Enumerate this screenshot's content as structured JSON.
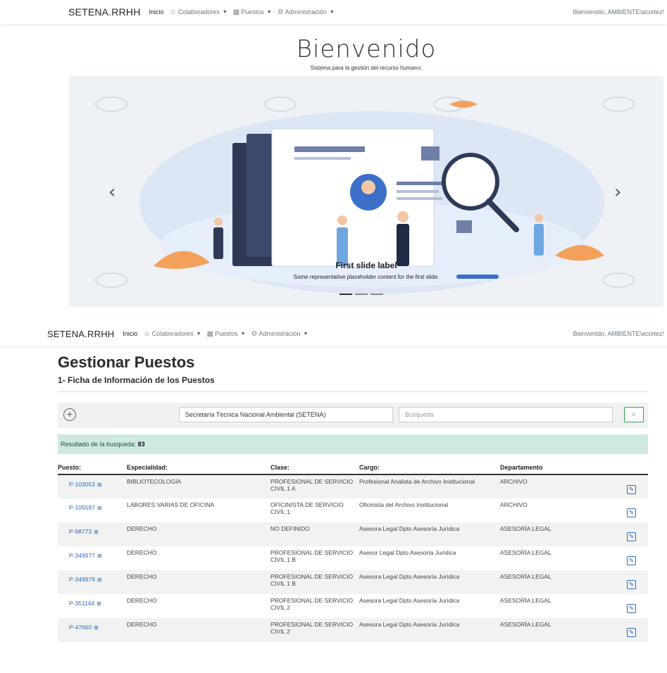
{
  "nav_top": {
    "brand": "SETENA.RRHH",
    "home": "Inicio",
    "colaboradores": "Colaboradores",
    "puestos": "Puestos",
    "administracion": "Administración",
    "welcome": "Bienvenido, AMBIENTE\\acortez!"
  },
  "nav_mid": {
    "brand": "SETENA.RRHH",
    "home": "Inicio",
    "colaboradores": "Colaboradores",
    "puestos": "Puestos",
    "administracion": "Administración",
    "welcome": "Bienvenido, AMBIENTE\\acortez!"
  },
  "hero": {
    "title": "Bienvenido",
    "subtitle": "Sistema para la gestión del recurso humano."
  },
  "carousel": {
    "prev_glyph": "‹",
    "next_glyph": "›",
    "caption_label": "First slide label",
    "caption_text": "Some representative placeholder content for the first slide."
  },
  "page": {
    "title": "Gestionar Puestos",
    "subtitle": "1- Ficha de Información de los Puestos"
  },
  "filters": {
    "add_glyph": "+",
    "institution": "Secretaría Técnica Nacional Ambiental (SETENA)",
    "search_placeholder": "Busqueda",
    "search_glyph": "⌕"
  },
  "result": {
    "label": "Resultado de la busqueda:",
    "count": "83"
  },
  "table": {
    "headers": [
      "Puesto:",
      "Especialidad:",
      "Clase:",
      "Cargo:",
      "Departamento"
    ],
    "rows": [
      {
        "puesto": "P-103053",
        "especialidad": "BIBLIOTECOLOGÍA",
        "clase": "PROFESIONAL DE SERVICIO CIVIL 1 A",
        "cargo": "Profesional Analista de Archivo Institucional",
        "departamento": "ARCHIVO"
      },
      {
        "puesto": "P-105597",
        "especialidad": "LABORES VARIAS DE OFICINA",
        "clase": "OFICINISTA DE SERVICIO CIVIL 1",
        "cargo": "Oficinista del Archivo Institucional",
        "departamento": "ARCHIVO"
      },
      {
        "puesto": "P-98773",
        "especialidad": "DERECHO",
        "clase": "NO DEFINIDO",
        "cargo": "Asesora Legal Dpto Asesoría Jurídica",
        "departamento": "ASESORÍA LEGAL"
      },
      {
        "puesto": "P-349977",
        "especialidad": "DERECHO",
        "clase": "PROFESIONAL DE SERVICIO CIVIL 1 B",
        "cargo": "Asesor Legal Dpto Asesoría Jurídica",
        "departamento": "ASESORÍA LEGAL"
      },
      {
        "puesto": "P-349979",
        "especialidad": "DERECHO",
        "clase": "PROFESIONAL DE SERVICIO CIVIL 1 B",
        "cargo": "Asesora Legal Dpto Asesoría Jurídica",
        "departamento": "ASESORÍA LEGAL"
      },
      {
        "puesto": "P-351144",
        "especialidad": "DERECHO",
        "clase": "PROFESIONAL DE SERVICIO CIVIL 2",
        "cargo": "Asesora Legal Dpto Asesoría Jurídica",
        "departamento": "ASESORÍA LEGAL"
      },
      {
        "puesto": "P-47660",
        "especialidad": "DERECHO",
        "clase": "PROFESIONAL DE SERVICIO CIVIL 2",
        "cargo": "Asesora Legal Dpto Asesoría Jurídica",
        "departamento": "ASESORÍA LEGAL"
      }
    ]
  },
  "icons": {
    "user_group": "people-icon",
    "calendar": "calendar-icon",
    "gear": "gear-icon",
    "external": "external-link-icon",
    "edit": "edit-icon"
  },
  "colors": {
    "link": "#2a6ebb",
    "alert_bg": "#cfe9df",
    "success": "#28a745"
  }
}
